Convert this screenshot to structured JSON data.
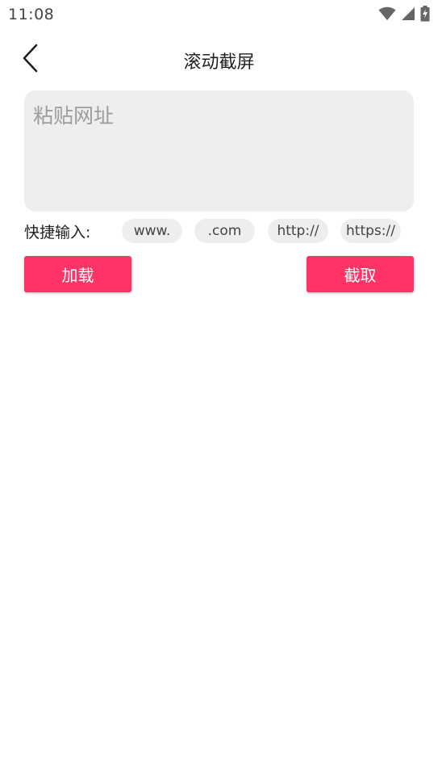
{
  "status_bar": {
    "time": "11:08",
    "icons": [
      "wifi-icon",
      "cell-signal-icon",
      "battery-charging-icon"
    ]
  },
  "header": {
    "back_icon": "chevron-left-icon",
    "title": "滚动截屏"
  },
  "url_input": {
    "placeholder": "粘贴网址",
    "value": ""
  },
  "quick_input": {
    "label": "快捷输入:",
    "chips": [
      "www.",
      ".com",
      "http://",
      "https://"
    ]
  },
  "actions": {
    "load_label": "加载",
    "capture_label": "截取"
  },
  "colors": {
    "accent": "#ff3366",
    "input_bg": "#eeeeee",
    "placeholder": "#9c9c9c"
  }
}
